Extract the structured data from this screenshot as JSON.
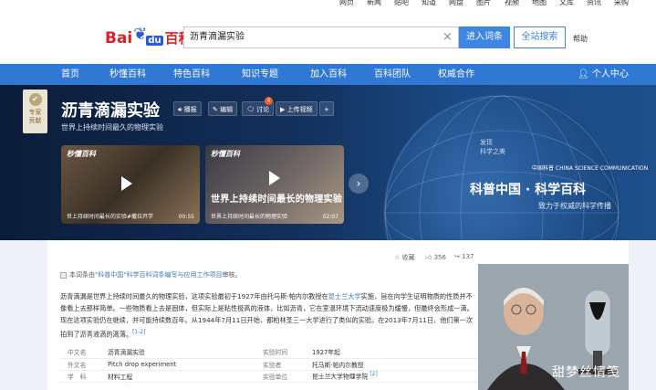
{
  "topnav": [
    "网页",
    "新闻",
    "贴吧",
    "知道",
    "网盘",
    "图片",
    "视频",
    "地图",
    "文库",
    "资讯",
    "采购"
  ],
  "header": {
    "logo": {
      "bai": "Bai",
      "du": "du",
      "baike": "百科"
    },
    "search_value": "沥青滴漏实验",
    "btn_entry": "进入词条",
    "btn_search": "全站搜索",
    "help": "帮助"
  },
  "nav": {
    "items": [
      "首页",
      "秒懂百科",
      "特色百科",
      "知识专题",
      "加入百科",
      "百科团队",
      "权威合作"
    ],
    "user": "个人中心"
  },
  "banner": {
    "badge": [
      "专家",
      "贡献"
    ],
    "title": "沥青滴漏实验",
    "subtitle": "世界上持续时间最久的物理实验",
    "toolbar": [
      "播报",
      "编辑",
      "讨论",
      "上传视频"
    ],
    "discussion_count": "4",
    "thumbs": [
      {
        "watermark": "秒懂百科",
        "caption": "世上持续时间最长的实验#撒拉开学",
        "duration": "00:55"
      },
      {
        "watermark": "秒懂百科",
        "big_text": "世界上持续时间最长的物理实验",
        "caption": "世界上持续时间最长的物理实验",
        "duration": "02:07"
      }
    ],
    "disc_label": "发现",
    "disc_text": "科学之美",
    "partner_logo": "中国科普 CHINA SCIENCE COMMUNICATION",
    "main_title": "科普中国 · 科学百科",
    "main_sub": "致力于权威的科学传播"
  },
  "card": {
    "actions": {
      "collect": "收藏",
      "likes": "356",
      "shares": "137"
    },
    "notice_prefix": "本词条由",
    "notice_link": "\"科普中国\"科学百科词条编写与应用工作项目",
    "notice_suffix": "审核。",
    "para_1": "沥青滴漏是世界上持续时间最久的物理实验，这项实验最初于1927年由托马斯·帕内尔教授在",
    "para_link": "昆士兰大学",
    "para_2": "实施，旨在向学生证明物质的性质并不像看上去那样简单。一些物质看上去是固体，但实际上是粘性极高的液体，比如沥青，它在室温环境下流动速度极为缓慢，但最终会形成一滴。现在这项实验仍在继续，并可能持续数百年。从1944年7月11日开始，都柏林圣三一大学进行了类似的实验。在2013年7月11日，他们第一次拍到了沥青液滴的滴落。",
    "para_ref": "[1-2]",
    "info": [
      [
        "中文名",
        "沥青滴漏实验",
        "实验时间",
        "1927年起"
      ],
      [
        "外文名",
        "Pitch drop experiment",
        "实验者",
        "托马斯·帕内尔教授"
      ],
      [
        "学　科",
        "材料工程",
        "实验单位",
        "昆士兰大学物理学院"
      ]
    ],
    "info_ref": "[2]",
    "photo_watermark": "甜梦丝情笺"
  }
}
